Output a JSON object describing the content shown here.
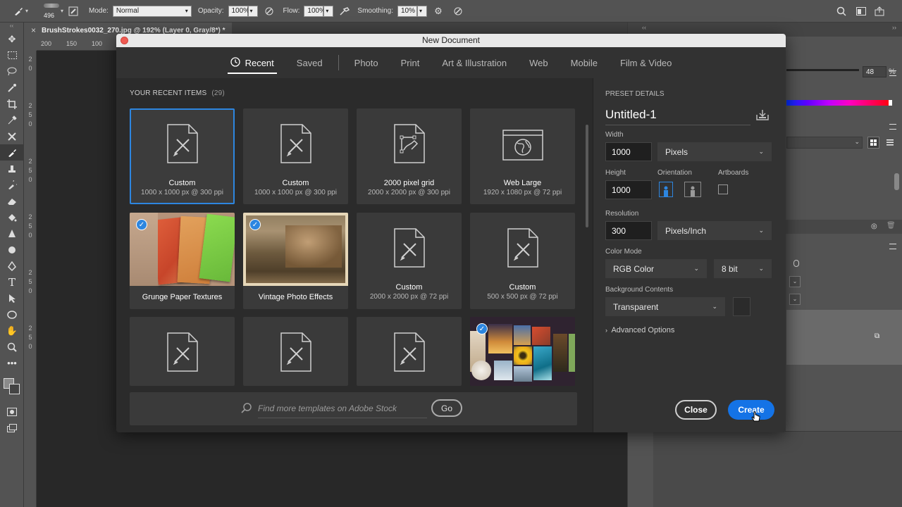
{
  "optbar": {
    "brush_size": "496",
    "mode_label": "Mode:",
    "mode_value": "Normal",
    "opacity_label": "Opacity:",
    "opacity_value": "100%",
    "flow_label": "Flow:",
    "flow_value": "100%",
    "smoothing_label": "Smoothing:",
    "smoothing_value": "10%"
  },
  "document_tab": {
    "title": "BrushStrokes0032_270.jpg @ 192% (Layer 0, Gray/8*) *",
    "close": "×"
  },
  "rulers": {
    "h_ticks": [
      "200",
      "150",
      "100"
    ],
    "v_ticks": [
      "2",
      "0",
      "2",
      "5",
      "0",
      "2",
      "5",
      "0",
      "2",
      "5",
      "0",
      "2",
      "5",
      "0",
      "2",
      "5",
      "0"
    ]
  },
  "right_panel": {
    "opacity_value": "48",
    "percent": "%"
  },
  "dialog": {
    "title": "New Document",
    "tabs": [
      {
        "label": "Recent",
        "active": true
      },
      {
        "label": "Saved"
      },
      {
        "label": "Photo"
      },
      {
        "label": "Print"
      },
      {
        "label": "Art & Illustration"
      },
      {
        "label": "Web"
      },
      {
        "label": "Mobile"
      },
      {
        "label": "Film & Video"
      }
    ],
    "recent_title": "YOUR RECENT ITEMS",
    "recent_count": "(29)",
    "items": [
      {
        "name": "Custom",
        "sub": "1000 x 1000 px @ 300 ppi",
        "icon": "document-brush-icon",
        "selected": true
      },
      {
        "name": "Custom",
        "sub": "1000 x 1000 px @ 300 ppi",
        "icon": "document-brush-icon"
      },
      {
        "name": "2000 pixel grid",
        "sub": "2000 x 2000 px @ 300 ppi",
        "icon": "document-pen-icon"
      },
      {
        "name": "Web Large",
        "sub": "1920 x 1080 px @ 72 ppi",
        "icon": "browser-globe-icon"
      },
      {
        "name": "Grunge Paper Textures",
        "sub": "",
        "icon": "template-thumbnail"
      },
      {
        "name": "Vintage Photo Effects",
        "sub": "",
        "icon": "template-thumbnail"
      },
      {
        "name": "Custom",
        "sub": "2000 x 2000 px @ 72 ppi",
        "icon": "document-brush-icon"
      },
      {
        "name": "Custom",
        "sub": "500 x 500 px @ 72 ppi",
        "icon": "document-brush-icon"
      }
    ],
    "search_placeholder": "Find more templates on Adobe Stock",
    "go_label": "Go",
    "preset": {
      "section_title": "PRESET DETAILS",
      "name": "Untitled-1",
      "width_label": "Width",
      "width_value": "1000",
      "width_unit": "Pixels",
      "height_label": "Height",
      "height_value": "1000",
      "orientation_label": "Orientation",
      "artboards_label": "Artboards",
      "resolution_label": "Resolution",
      "resolution_value": "300",
      "resolution_unit": "Pixels/Inch",
      "color_mode_label": "Color Mode",
      "color_mode_value": "RGB Color",
      "bit_depth": "8 bit",
      "background_label": "Background Contents",
      "background_value": "Transparent",
      "advanced_label": "Advanced Options"
    },
    "close_label": "Close",
    "create_label": "Create"
  },
  "colors": {
    "accent": "#1473e6",
    "selection": "#2d86e0",
    "dialog_bg": "#2b2b2b"
  }
}
